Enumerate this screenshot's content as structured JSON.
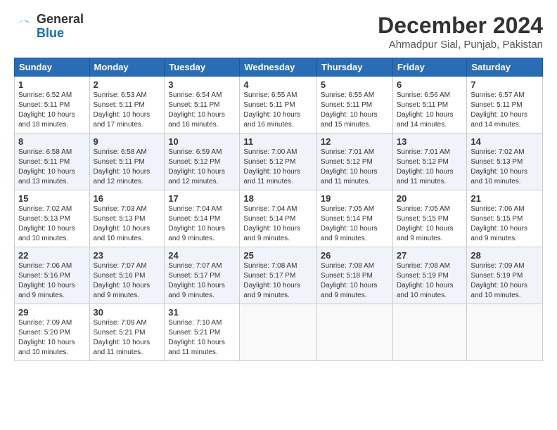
{
  "logo": {
    "line1": "General",
    "line2": "Blue"
  },
  "title": "December 2024",
  "subtitle": "Ahmadpur Sial, Punjab, Pakistan",
  "weekdays": [
    "Sunday",
    "Monday",
    "Tuesday",
    "Wednesday",
    "Thursday",
    "Friday",
    "Saturday"
  ],
  "weeks": [
    [
      {
        "day": "1",
        "info": "Sunrise: 6:52 AM\nSunset: 5:11 PM\nDaylight: 10 hours\nand 18 minutes."
      },
      {
        "day": "2",
        "info": "Sunrise: 6:53 AM\nSunset: 5:11 PM\nDaylight: 10 hours\nand 17 minutes."
      },
      {
        "day": "3",
        "info": "Sunrise: 6:54 AM\nSunset: 5:11 PM\nDaylight: 10 hours\nand 16 minutes."
      },
      {
        "day": "4",
        "info": "Sunrise: 6:55 AM\nSunset: 5:11 PM\nDaylight: 10 hours\nand 16 minutes."
      },
      {
        "day": "5",
        "info": "Sunrise: 6:55 AM\nSunset: 5:11 PM\nDaylight: 10 hours\nand 15 minutes."
      },
      {
        "day": "6",
        "info": "Sunrise: 6:56 AM\nSunset: 5:11 PM\nDaylight: 10 hours\nand 14 minutes."
      },
      {
        "day": "7",
        "info": "Sunrise: 6:57 AM\nSunset: 5:11 PM\nDaylight: 10 hours\nand 14 minutes."
      }
    ],
    [
      {
        "day": "8",
        "info": "Sunrise: 6:58 AM\nSunset: 5:11 PM\nDaylight: 10 hours\nand 13 minutes."
      },
      {
        "day": "9",
        "info": "Sunrise: 6:58 AM\nSunset: 5:11 PM\nDaylight: 10 hours\nand 12 minutes."
      },
      {
        "day": "10",
        "info": "Sunrise: 6:59 AM\nSunset: 5:12 PM\nDaylight: 10 hours\nand 12 minutes."
      },
      {
        "day": "11",
        "info": "Sunrise: 7:00 AM\nSunset: 5:12 PM\nDaylight: 10 hours\nand 11 minutes."
      },
      {
        "day": "12",
        "info": "Sunrise: 7:01 AM\nSunset: 5:12 PM\nDaylight: 10 hours\nand 11 minutes."
      },
      {
        "day": "13",
        "info": "Sunrise: 7:01 AM\nSunset: 5:12 PM\nDaylight: 10 hours\nand 11 minutes."
      },
      {
        "day": "14",
        "info": "Sunrise: 7:02 AM\nSunset: 5:13 PM\nDaylight: 10 hours\nand 10 minutes."
      }
    ],
    [
      {
        "day": "15",
        "info": "Sunrise: 7:02 AM\nSunset: 5:13 PM\nDaylight: 10 hours\nand 10 minutes."
      },
      {
        "day": "16",
        "info": "Sunrise: 7:03 AM\nSunset: 5:13 PM\nDaylight: 10 hours\nand 10 minutes."
      },
      {
        "day": "17",
        "info": "Sunrise: 7:04 AM\nSunset: 5:14 PM\nDaylight: 10 hours\nand 9 minutes."
      },
      {
        "day": "18",
        "info": "Sunrise: 7:04 AM\nSunset: 5:14 PM\nDaylight: 10 hours\nand 9 minutes."
      },
      {
        "day": "19",
        "info": "Sunrise: 7:05 AM\nSunset: 5:14 PM\nDaylight: 10 hours\nand 9 minutes."
      },
      {
        "day": "20",
        "info": "Sunrise: 7:05 AM\nSunset: 5:15 PM\nDaylight: 10 hours\nand 9 minutes."
      },
      {
        "day": "21",
        "info": "Sunrise: 7:06 AM\nSunset: 5:15 PM\nDaylight: 10 hours\nand 9 minutes."
      }
    ],
    [
      {
        "day": "22",
        "info": "Sunrise: 7:06 AM\nSunset: 5:16 PM\nDaylight: 10 hours\nand 9 minutes."
      },
      {
        "day": "23",
        "info": "Sunrise: 7:07 AM\nSunset: 5:16 PM\nDaylight: 10 hours\nand 9 minutes."
      },
      {
        "day": "24",
        "info": "Sunrise: 7:07 AM\nSunset: 5:17 PM\nDaylight: 10 hours\nand 9 minutes."
      },
      {
        "day": "25",
        "info": "Sunrise: 7:08 AM\nSunset: 5:17 PM\nDaylight: 10 hours\nand 9 minutes."
      },
      {
        "day": "26",
        "info": "Sunrise: 7:08 AM\nSunset: 5:18 PM\nDaylight: 10 hours\nand 9 minutes."
      },
      {
        "day": "27",
        "info": "Sunrise: 7:08 AM\nSunset: 5:19 PM\nDaylight: 10 hours\nand 10 minutes."
      },
      {
        "day": "28",
        "info": "Sunrise: 7:09 AM\nSunset: 5:19 PM\nDaylight: 10 hours\nand 10 minutes."
      }
    ],
    [
      {
        "day": "29",
        "info": "Sunrise: 7:09 AM\nSunset: 5:20 PM\nDaylight: 10 hours\nand 10 minutes."
      },
      {
        "day": "30",
        "info": "Sunrise: 7:09 AM\nSunset: 5:21 PM\nDaylight: 10 hours\nand 11 minutes."
      },
      {
        "day": "31",
        "info": "Sunrise: 7:10 AM\nSunset: 5:21 PM\nDaylight: 10 hours\nand 11 minutes."
      },
      {
        "day": "",
        "info": ""
      },
      {
        "day": "",
        "info": ""
      },
      {
        "day": "",
        "info": ""
      },
      {
        "day": "",
        "info": ""
      }
    ]
  ]
}
